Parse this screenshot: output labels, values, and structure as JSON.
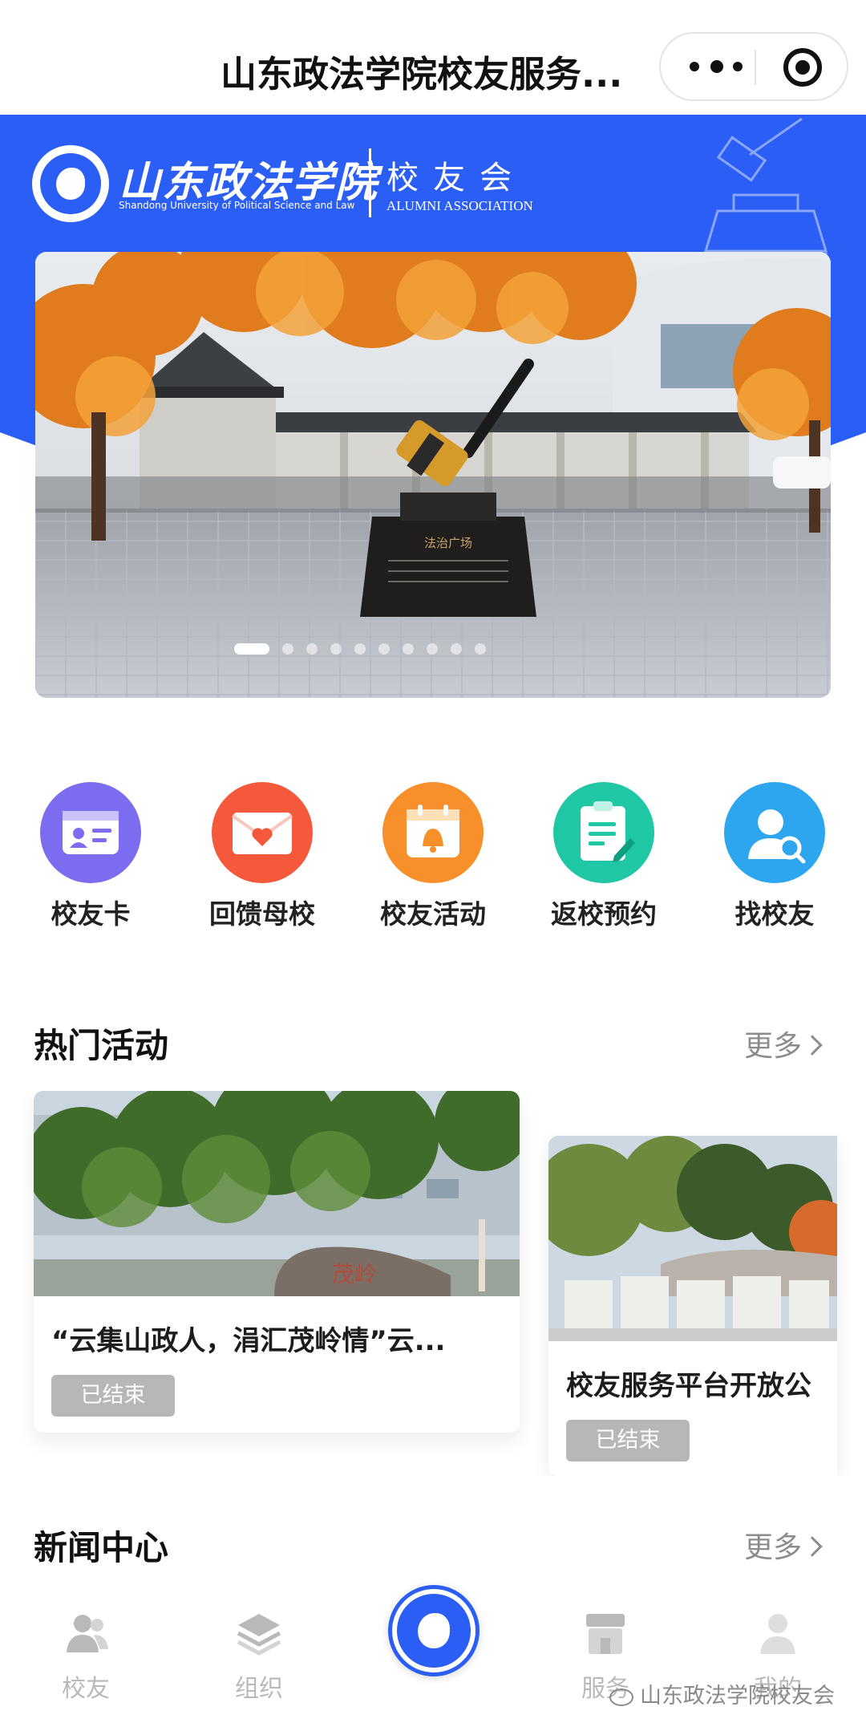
{
  "titlebar": {
    "title": "山东政法学院校友服务..."
  },
  "header": {
    "school_name_cn": "山东政法学院",
    "school_name_en": "Shandong University of Political Science and Law",
    "association_cn": "校友会",
    "association_en": "ALUMNI ASSOCIATION",
    "brand_color": "#2a5ef5"
  },
  "banner": {
    "slide_count": 10,
    "active_index": 0
  },
  "quick_menu": [
    {
      "label": "校友卡",
      "icon": "id-card-icon",
      "color": "#7b6cf0"
    },
    {
      "label": "回馈母校",
      "icon": "envelope-heart-icon",
      "color": "#f4593b"
    },
    {
      "label": "校友活动",
      "icon": "calendar-bell-icon",
      "color": "#f7902a"
    },
    {
      "label": "返校预约",
      "icon": "clipboard-pen-icon",
      "color": "#20c7a5"
    },
    {
      "label": "找校友",
      "icon": "person-search-icon",
      "color": "#2da6ef"
    }
  ],
  "hot_activities": {
    "title": "热门活动",
    "more": "更多",
    "cards": [
      {
        "title": "“云集山政人，涓汇茂岭情”云...",
        "status": "已结束"
      },
      {
        "title": "校友服务平台开放公",
        "status": "已结束"
      }
    ]
  },
  "news_center": {
    "title": "新闻中心",
    "more": "更多"
  },
  "tabbar": {
    "items": [
      {
        "label": "校友",
        "icon": "people-icon"
      },
      {
        "label": "组织",
        "icon": "layers-icon"
      },
      {
        "label": "服务",
        "icon": "store-icon"
      },
      {
        "label": "我的",
        "icon": "user-icon"
      }
    ],
    "inactive_color": "#b9b9b9"
  },
  "watermark": {
    "text": "山东政法学院校友会"
  }
}
